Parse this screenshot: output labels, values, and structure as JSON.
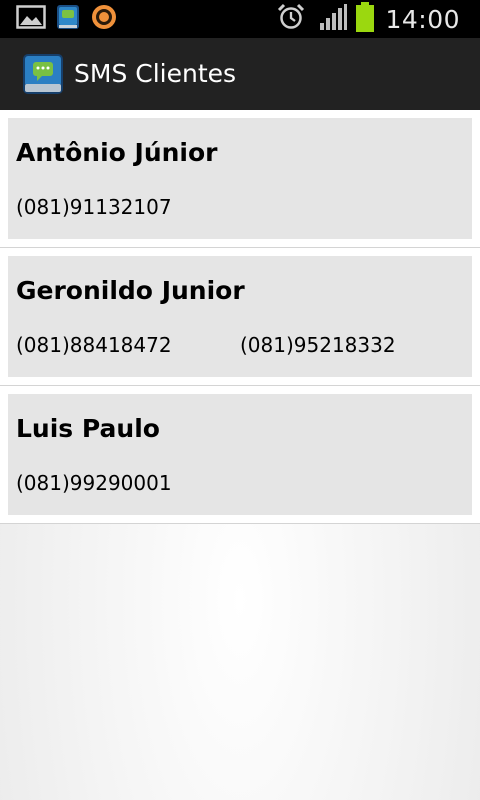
{
  "status_bar": {
    "time": "14:00",
    "icons": [
      "gallery-icon",
      "sms-clientes-notification-icon",
      "orange-circle-icon",
      "alarm-clock-icon",
      "signal-icon",
      "battery-icon"
    ],
    "battery_color": "#9bd80f"
  },
  "action_bar": {
    "title": "SMS Clientes",
    "icon": "sms-clientes-app-icon"
  },
  "contacts": [
    {
      "name": "Antônio Júnior",
      "phones": [
        "(081)91132107"
      ]
    },
    {
      "name": "Geronildo Junior",
      "phones": [
        "(081)88418472",
        "(081)95218332"
      ]
    },
    {
      "name": "Luis Paulo",
      "phones": [
        "(081)99290001"
      ]
    }
  ]
}
